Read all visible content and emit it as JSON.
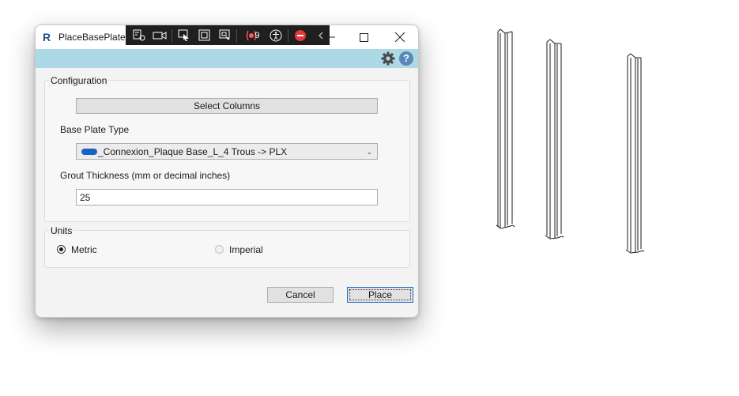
{
  "window": {
    "title": "PlaceBasePlate",
    "app_icon_letter": "R"
  },
  "debug_toolbar": {
    "icons": [
      "live-visual-tree-icon",
      "camera-icon",
      "select-element-icon",
      "display-layout-adorners-icon",
      "track-focus-icon",
      "binding-failures-icon",
      "accessibility-icon",
      "hot-reload-stop-icon",
      "collapse-icon"
    ],
    "binding_failures_count": "9"
  },
  "header_band": {
    "icons": [
      "gear-icon",
      "help-icon"
    ],
    "help_glyph": "?"
  },
  "configuration": {
    "group_label": "Configuration",
    "select_columns_label": "Select Columns",
    "base_plate_type_label": "Base Plate Type",
    "base_plate_type_value": "_Connexion_Plaque Base_L_4 Trous -> PLX",
    "grout_label": "Grout Thickness (mm or decimal inches)",
    "grout_value": "25"
  },
  "units": {
    "group_label": "Units",
    "metric_label": "Metric",
    "imperial_label": "Imperial",
    "selected": "Metric"
  },
  "actions": {
    "cancel_label": "Cancel",
    "place_label": "Place"
  },
  "colors": {
    "band": "#add8e6",
    "button_face": "#e1e1e1",
    "accent_blue": "#1565c0"
  }
}
